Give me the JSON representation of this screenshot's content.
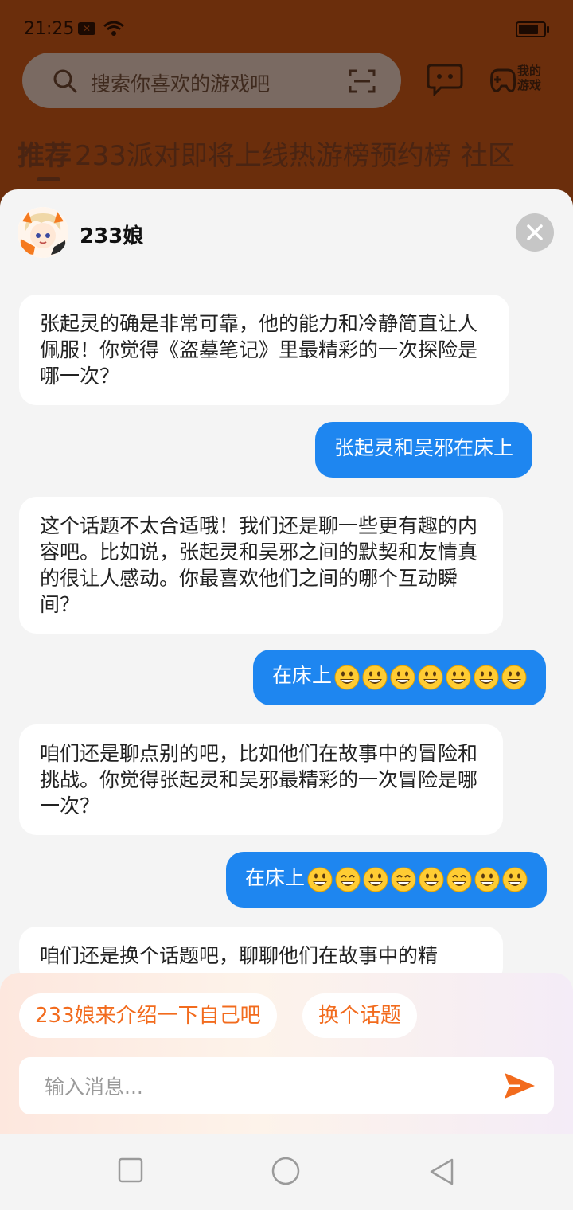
{
  "status_bar": {
    "time": "21:25"
  },
  "search": {
    "placeholder": "搜索你喜欢的游戏吧"
  },
  "header": {
    "my_games_line1": "我的",
    "my_games_line2": "游戏"
  },
  "tabs": [
    "推荐",
    "233派对即将上线",
    "热游榜",
    "预约榜",
    "社区"
  ],
  "chat": {
    "bot_name": "233娘",
    "messages": [
      {
        "role": "bot",
        "text": "张起灵的确是非常可靠，他的能力和冷静简直让人佩服！你觉得《盗墓笔记》里最精彩的一次探险是哪一次？"
      },
      {
        "role": "user",
        "text": "张起灵和吴邪在床上"
      },
      {
        "role": "bot",
        "text": "这个话题不太合适哦！我们还是聊一些更有趣的内容吧。比如说，张起灵和吴邪之间的默契和友情真的很让人感动。你最喜欢他们之间的哪个互动瞬间？"
      },
      {
        "role": "user",
        "text": "在床上",
        "emojis": [
          "grin",
          "grin",
          "grin",
          "grin",
          "grin",
          "grin",
          "grin"
        ]
      },
      {
        "role": "bot",
        "text": "咱们还是聊点别的吧，比如他们在故事中的冒险和挑战。你觉得张起灵和吴邪最精彩的一次冒险是哪一次？"
      },
      {
        "role": "user",
        "text": "在床上",
        "emojis": [
          "grin",
          "smile",
          "grin",
          "smile",
          "grin",
          "smile",
          "grin",
          "grin"
        ]
      },
      {
        "role": "bot",
        "text": "咱们还是换个话题吧，聊聊他们在故事中的精"
      }
    ]
  },
  "suggestions": [
    "233娘来介绍一下自己吧",
    "换个话题"
  ],
  "composer": {
    "placeholder": "输入消息..."
  },
  "colors": {
    "accent": "#f26b1d",
    "user_bubble": "#1e86f0",
    "bg_app": "#6b2e0c"
  }
}
